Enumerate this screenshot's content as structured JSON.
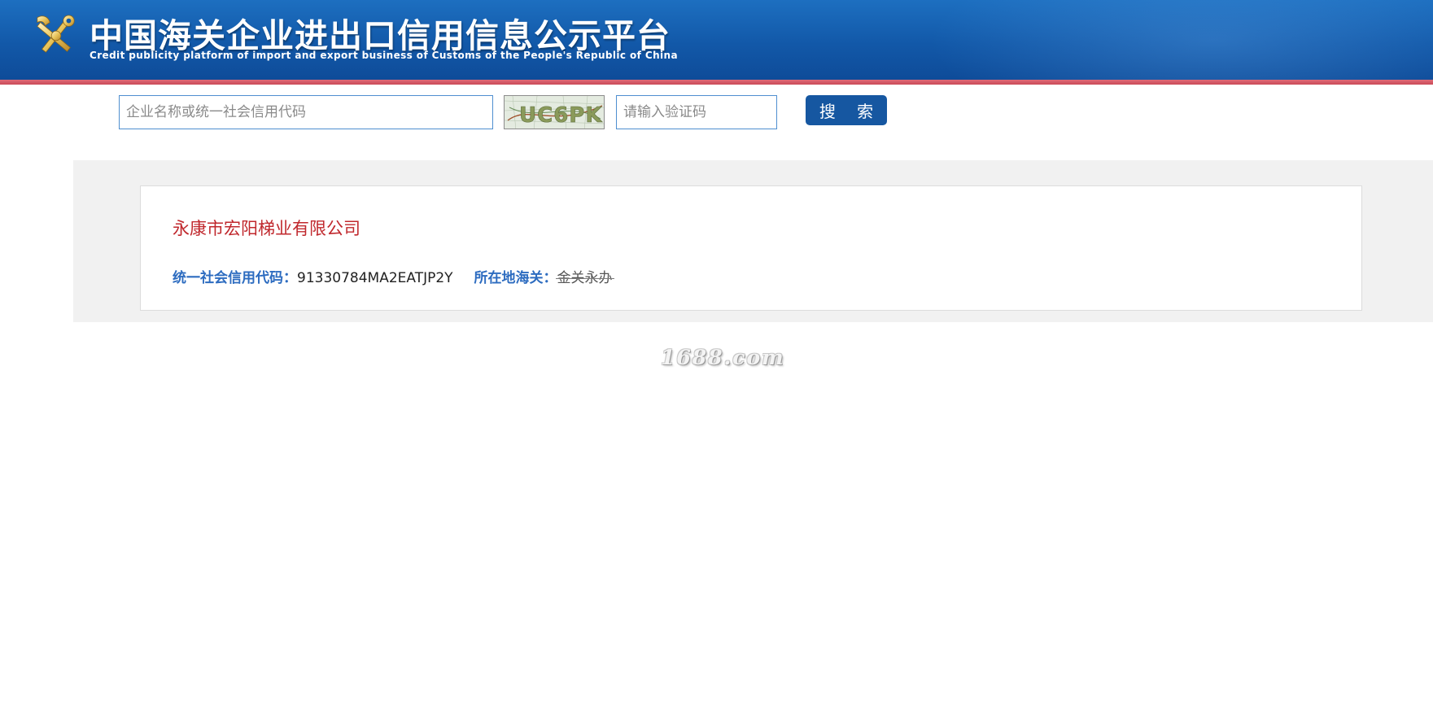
{
  "header": {
    "title": "中国海关企业进出口信用信息公示平台",
    "subtitle": "Credit publicity platform of import and export business of Customs of the People's Republic of China",
    "logo_icon": "customs-emblem-icon"
  },
  "search": {
    "company_placeholder": "企业名称或统一社会信用代码",
    "company_value": "",
    "captcha_text": "UC6PK",
    "captcha_placeholder": "请输入验证码",
    "captcha_value": "",
    "button_label": "搜 索"
  },
  "result": {
    "company_name": "永康市宏阳梯业有限公司",
    "credit_code_label": "统一社会信用代码：",
    "credit_code": "91330784MA2EATJP2Y",
    "customs_label": "所在地海关：",
    "customs_value": "金关永办"
  },
  "watermark": "1688.com",
  "colors": {
    "header_blue": "#1258a8",
    "header_stripe": "#c94a58",
    "button_blue": "#1657a1",
    "company_red": "#c0282d",
    "label_blue": "#2d6cc0"
  }
}
